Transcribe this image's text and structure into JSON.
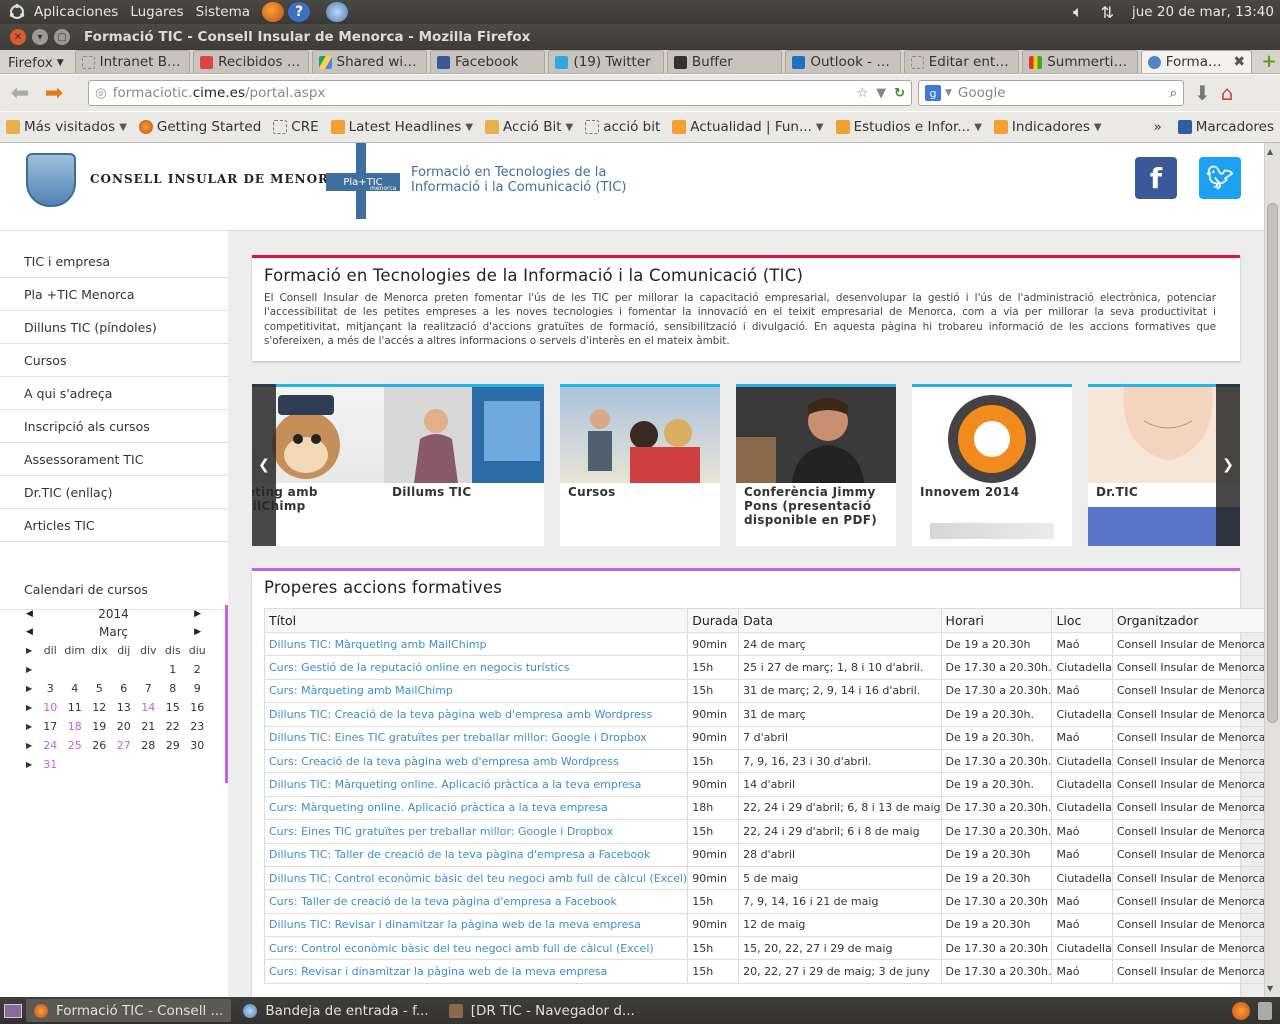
{
  "panel": {
    "menus": [
      "Aplicaciones",
      "Lugares",
      "Sistema"
    ],
    "clock": "jue 20 de mar, 13:40"
  },
  "window": {
    "title": "Formació TIC - Consell Insular de Menorca - Mozilla Firefox"
  },
  "tabs": {
    "menu_label": "Firefox",
    "items": [
      {
        "label": "Intranet BITel"
      },
      {
        "label": "Recibidos - ..."
      },
      {
        "label": "Shared wit..."
      },
      {
        "label": "Facebook"
      },
      {
        "label": "(19) Twitter"
      },
      {
        "label": "Buffer"
      },
      {
        "label": "Outlook - fr..."
      },
      {
        "label": "Editar entr..."
      },
      {
        "label": "Summertim..."
      },
      {
        "label": "Formaci..."
      }
    ]
  },
  "nav": {
    "url_pre": "formaciotic.",
    "url_host": "cime.es",
    "url_path": "/portal.aspx",
    "search_placeholder": "Google"
  },
  "bookmarks": {
    "items": [
      {
        "label": "Más visitados"
      },
      {
        "label": "Getting Started"
      },
      {
        "label": "CRE"
      },
      {
        "label": "Latest Headlines"
      },
      {
        "label": "Acció Bit"
      },
      {
        "label": "acció bit"
      },
      {
        "label": "Actualidad | Fun..."
      },
      {
        "label": "Estudios e Infor..."
      },
      {
        "label": "Indicadores"
      }
    ],
    "more": "»",
    "marcadores": "Marcadores"
  },
  "site": {
    "consell": "CONSELL INSULAR DE MENORCA",
    "platic_mark": "Pla+TIC",
    "platic_small": "menorca",
    "title_line1": "Formació en Tecnologies de la",
    "title_line2": "Informació i la Comunicació (TIC)"
  },
  "sidebar": {
    "items": [
      {
        "label": "TIC i empresa"
      },
      {
        "label": "Pla +TIC Menorca"
      },
      {
        "label": "Dilluns TIC (píndoles)"
      },
      {
        "label": "Cursos"
      },
      {
        "label": "A qui s'adreça"
      },
      {
        "label": "Inscripció als cursos"
      },
      {
        "label": "Assessorament TIC"
      },
      {
        "label": "Dr.TIC (enllaç)"
      },
      {
        "label": "Articles TIC"
      }
    ],
    "calendar_link": "Calendari de cursos"
  },
  "calendar": {
    "year": "2014",
    "month": "Març",
    "days": [
      "dil",
      "dim",
      "dix",
      "dij",
      "div",
      "dis",
      "diu"
    ],
    "weeks": [
      [
        "",
        "",
        "",
        "",
        "",
        "1",
        "2"
      ],
      [
        "3",
        "4",
        "5",
        "6",
        "7",
        "8",
        "9"
      ],
      [
        "10",
        "11",
        "12",
        "13",
        "14",
        "15",
        "16"
      ],
      [
        "17",
        "18",
        "19",
        "20",
        "21",
        "22",
        "23"
      ],
      [
        "24",
        "25",
        "26",
        "27",
        "28",
        "29",
        "30"
      ],
      [
        "31",
        "",
        "",
        "",
        "",
        "",
        ""
      ]
    ]
  },
  "intro": {
    "title": "Formació en Tecnologies de la Informació i la Comunicació (TIC)",
    "text": "El Consell Insular de Menorca preten fomentar l'ús de les TIC per millorar la capacitació empresarial, desenvolupar la gestió i l'ús de l'administració electrònica, potenciar l'accessibilitat de les petites empreses a les noves tecnologies i fomentar la innovació en el teixit empresarial de Menorca, com a via per millorar la seva productivitat i competitivitat, mitjançant la realització d'accions gratuïtes de formació, sensibilització i divulgació. En aquesta pàgina hi trobareu informació de les accions formatives que s'ofereixen, a més de l'accés a altres informacions o serveis d'interès en el mateix àmbit."
  },
  "carousel": {
    "cards": [
      {
        "label": "...eting amb MailChimp"
      },
      {
        "label": "Dillums TIC"
      },
      {
        "label": "Cursos"
      },
      {
        "label": "Conferència Jimmy Pons (presentació disponible en PDF)"
      },
      {
        "label": "Innovem 2014"
      },
      {
        "label": "Dr.TIC"
      }
    ]
  },
  "courses": {
    "title": "Properes accions formatives",
    "headers": [
      "Títol",
      "Durada",
      "Data",
      "Horari",
      "Lloc",
      "Organitzador"
    ],
    "rows": [
      [
        "Dilluns TIC: Màrqueting amb MailChimp",
        "90min",
        "24 de març",
        "De 19 a 20.30h",
        "Maó",
        "Consell Insular de Menorca"
      ],
      [
        "Curs: Gestió de la reputació online en negocis turístics",
        "15h",
        "25 i 27 de març; 1, 8 i 10 d'abril.",
        "De 17.30 a 20.30h.",
        "Ciutadella",
        "Consell Insular de Menorca"
      ],
      [
        "Curs: Màrqueting amb MailChimp",
        "15h",
        "31 de març; 2, 9, 14 i 16 d'abril.",
        "De 17.30 a 20.30h.",
        "Maó",
        "Consell Insular de Menorca"
      ],
      [
        "Dilluns TIC: Creació de la teva pàgina web d'empresa amb Wordpress",
        "90min",
        "31 de març",
        "De 19 a 20.30h.",
        "Ciutadella",
        "Consell Insular de Menorca"
      ],
      [
        "Dilluns TIC: Eines TIC gratuïtes per treballar millor: Google i Dropbox",
        "90min",
        "7 d'abril",
        "De 19 a 20.30h.",
        "Maó",
        "Consell Insular de Menorca"
      ],
      [
        "Curs: Creació de la teva pàgina web d'empresa amb Wordpress",
        "15h",
        "7, 9, 16, 23 i 30 d'abril.",
        "De 17.30 a 20.30h.",
        "Ciutadella",
        "Consell Insular de Menorca"
      ],
      [
        "Dilluns TIC: Màrqueting online. Aplicació pràctica a la teva empresa",
        "90min",
        "14 d'abril",
        "De 19 a 20.30h.",
        "Ciutadella",
        "Consell Insular de Menorca"
      ],
      [
        "Curs: Màrqueting online. Aplicació pràctica a la teva empresa",
        "18h",
        "22, 24 i 29 d'abril; 6, 8 i 13 de maig",
        "De 17.30 a 20.30h.",
        "Ciutadella",
        "Consell Insular de Menorca"
      ],
      [
        "Curs: Eines TIC gratuïtes per treballar millor: Google i Dropbox",
        "15h",
        "22, 24 i 29 d'abril; 6 i 8 de maig",
        "De 17.30 a 20.30h.",
        "Maó",
        "Consell Insular de Menorca"
      ],
      [
        "Dilluns TIC: Taller de creació de la teva pàgina d'empresa a Facebook",
        "90min",
        "28 d'abril",
        "De 19 a 20.30h",
        "Maó",
        "Consell Insular de Menorca"
      ],
      [
        "Dilluns TIC: Control econòmic bàsic del teu negoci amb full de càlcul (Excel)",
        "90min",
        "5 de maig",
        "De 19 a 20.30h",
        "Ciutadella",
        "Consell Insular de Menorca"
      ],
      [
        "Curs: Taller de creació de la teva pàgina d'empresa a Facebook",
        "15h",
        "7, 9, 14, 16 i 21 de maig",
        "De 17.30 a 20.30h",
        "Maó",
        "Consell Insular de Menorca"
      ],
      [
        "Dilluns TIC: Revisar i dinamitzar la pàgina web de la meva empresa",
        "90min",
        "12 de maig",
        "De 19 a 20.30h",
        "Maó",
        "Consell Insular de Menorca"
      ],
      [
        "Curs: Control econòmic bàsic del teu negoci amb full de càlcul (Excel)",
        "15h",
        "15, 20, 22, 27 i 29 de maig",
        "De 17.30 a 20.30h",
        "Ciutadella",
        "Consell Insular de Menorca"
      ],
      [
        "Curs: Revisar i dinamitzar la pàgina web de la meva empresa",
        "15h",
        "20, 22, 27 i 29 de maig; 3 de juny",
        "De 17.30 a 20.30h.",
        "Maó",
        "Consell Insular de Menorca"
      ]
    ]
  },
  "taskbar": {
    "items": [
      {
        "label": "Formació TIC - Consell ..."
      },
      {
        "label": "Bandeja de entrada - f..."
      },
      {
        "label": "[DR TIC - Navegador d..."
      }
    ]
  }
}
